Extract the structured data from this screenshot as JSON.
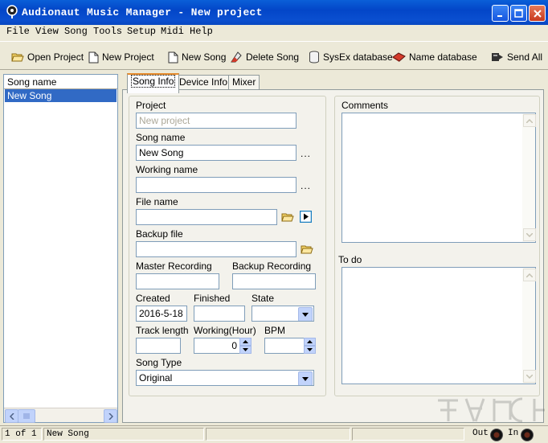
{
  "window": {
    "title": "Audionaut Music Manager - New project"
  },
  "menu": [
    "File",
    "View",
    "Song",
    "Tools",
    "Setup",
    "Midi",
    "Help"
  ],
  "toolbar": {
    "open_project": "Open Project",
    "new_project": "New Project",
    "new_song": "New Song",
    "delete_song": "Delete Song",
    "sysex_database": "SysEx database",
    "name_database": "Name database",
    "send_all": "Send All"
  },
  "song_list": {
    "header": "Song name",
    "items": [
      "New Song"
    ]
  },
  "tabs": [
    "Song Info",
    "Device Info",
    "Mixer"
  ],
  "form": {
    "project_label": "Project",
    "project_placeholder": "New project",
    "song_name_label": "Song name",
    "song_name_value": "New Song",
    "working_name_label": "Working name",
    "working_name_value": "",
    "file_name_label": "File name",
    "file_name_value": "",
    "backup_file_label": "Backup file",
    "backup_file_value": "",
    "master_recording_label": "Master Recording",
    "backup_recording_label": "Backup Recording",
    "created_label": "Created",
    "created_value": "2016-5-18",
    "finished_label": "Finished",
    "state_label": "State",
    "track_length_label": "Track length",
    "working_hour_label": "Working(Hour)",
    "working_hour_value": "0",
    "bpm_label": "BPM",
    "song_type_label": "Song Type",
    "song_type_value": "Original",
    "ellipsis": "..."
  },
  "comments": {
    "label": "Comments"
  },
  "todo": {
    "label": "To do"
  },
  "statusbar": {
    "position": "1 of 1",
    "song": "New Song",
    "out_label": "Out",
    "in_label": "In"
  },
  "colors": {
    "titlebar": "#0A4FD0",
    "selection": "#316AC5",
    "face": "#ECE9D8"
  }
}
